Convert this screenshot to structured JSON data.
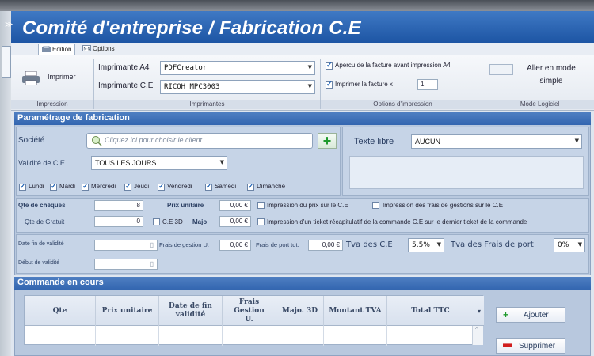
{
  "window": {
    "title": "Comité d'entreprise / Fabrication C.E"
  },
  "ribbon_tabs": [
    {
      "label": "Edition"
    },
    {
      "label": "Options"
    }
  ],
  "ribbon": {
    "imprimer_label": "Imprimer",
    "groups": {
      "impression": "Impression",
      "imprimantes": "Imprimantes",
      "options": "Options d'impression",
      "mode": "Mode Logiciel"
    },
    "printer_a4_label": "Imprimante A4",
    "printer_a4_value": "PDFCreator",
    "printer_ce_label": "Imprimante C.E",
    "printer_ce_value": "RICOH MPC3003",
    "apercu_label": "Apercu de la facture avant impression A4",
    "imprimer_facture_label": "Imprimer la facture x",
    "copies_value": "1",
    "mode_button_label": "Aller en mode simple"
  },
  "param": {
    "header": "Paramétrage de fabrication",
    "societe_label": "Société",
    "societe_placeholder": "Cliquez ici pour choisir le client",
    "texte_libre_label": "Texte libre",
    "texte_libre_value": "AUCUN",
    "validite_label": "Validité de C.E",
    "validite_value": "TOUS LES JOURS",
    "days": [
      {
        "label": "Lundi",
        "checked": true
      },
      {
        "label": "Mardi",
        "checked": true
      },
      {
        "label": "Mercredi",
        "checked": true
      },
      {
        "label": "Jeudi",
        "checked": true
      },
      {
        "label": "Vendredi",
        "checked": true
      },
      {
        "label": "Samedi",
        "checked": true
      },
      {
        "label": "Dimanche",
        "checked": true
      }
    ],
    "qte_cheques_label": "Qte de chèques",
    "qte_cheques_value": "8",
    "prix_unitaire_label": "Prix unitaire",
    "prix_unitaire_value": "0,00 €",
    "impression_prix_label": "Impression du prix sur le C.E",
    "impression_frais_label": "Impression des frais de gestions sur le C.E",
    "qte_gratuit_label": "Qte de Gratuit",
    "qte_gratuit_value": "0",
    "ce3d_label": "C.E 3D",
    "majo_label": "Majo",
    "majo_value": "0,00 €",
    "impression_ticket_label": "Impression d'un ticket récapitulatif de la commande C.E sur le dernier ticket de la commande",
    "date_fin_label": "Date fin de validité",
    "date_fin_value": "",
    "debut_label": "Début de validité",
    "debut_value": "",
    "frais_gestion_label": "Frais de gestion U.",
    "frais_gestion_value": "0,00 €",
    "frais_port_label": "Frais de port tot.",
    "frais_port_value": "0,00 €",
    "tva_ce_label": "Tva des C.E",
    "tva_ce_value": "5.5%",
    "tva_port_label": "Tva des Frais de port",
    "tva_port_value": "0%"
  },
  "commande": {
    "header": "Commande en cours",
    "columns": [
      "Qte",
      "Prix unitaire",
      "Date de fin validité",
      "Frais Gestion U.",
      "Majo. 3D",
      "Montant TVA",
      "Total TTC"
    ],
    "ajouter_label": "Ajouter",
    "supprimer_label": "Supprimer"
  },
  "colors": {
    "title_blue": "#2a62b3",
    "section_header": "#4275bd",
    "add_green": "#1e9a2c",
    "remove_red": "#d11f1f"
  },
  "icons": [
    "printer-icon",
    "search-icon",
    "plus-icon",
    "minus-icon",
    "dropdown-arrow-icon"
  ]
}
